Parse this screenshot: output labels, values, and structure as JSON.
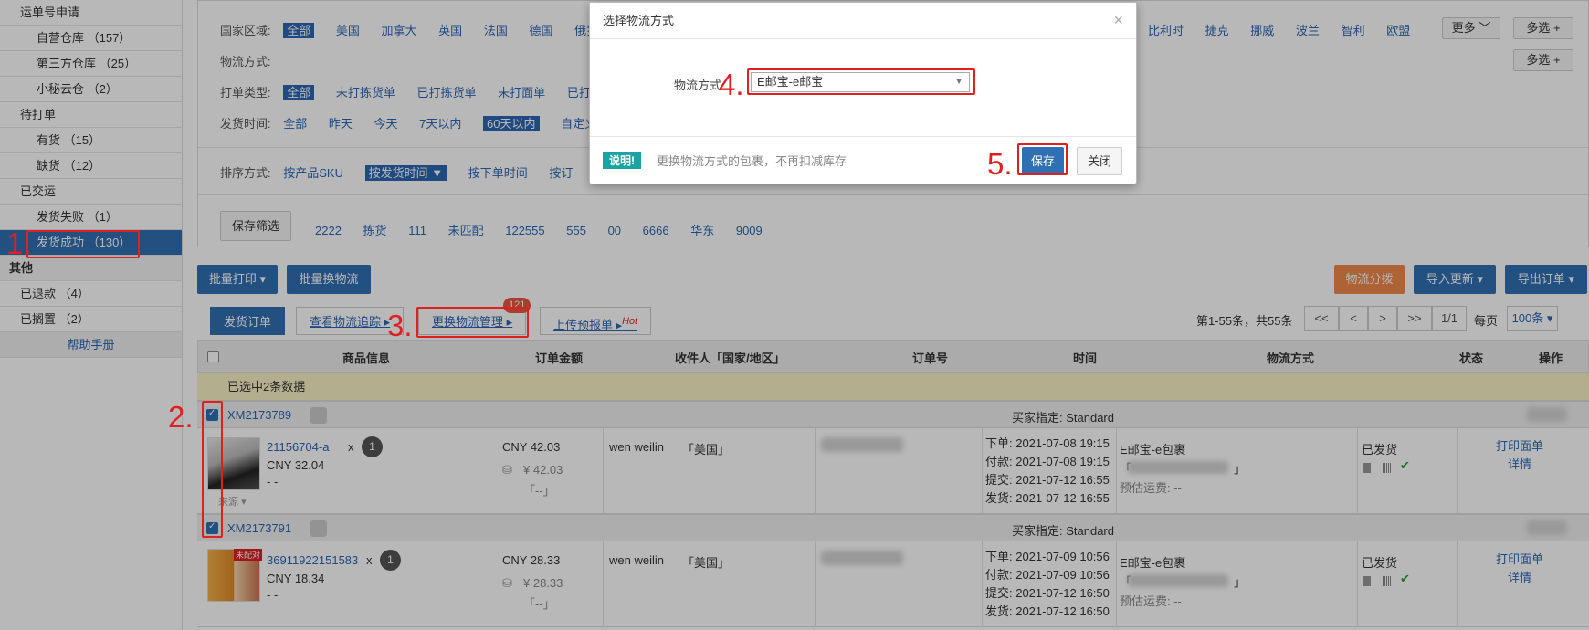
{
  "sidebar": {
    "items": [
      {
        "label": "运单号申请",
        "kind": "grp"
      },
      {
        "label": "自营仓库 （157）",
        "kind": "sub"
      },
      {
        "label": "第三方仓库 （25）",
        "kind": "sub"
      },
      {
        "label": "小秘云仓 （2）",
        "kind": "sub"
      },
      {
        "label": "待打单",
        "kind": "grp2"
      },
      {
        "label": "有货 （15）",
        "kind": "sub"
      },
      {
        "label": "缺货 （12）",
        "kind": "sub"
      },
      {
        "label": "已交运",
        "kind": "grp2"
      },
      {
        "label": "发货失败 （1）",
        "kind": "sub"
      },
      {
        "label": "发货成功 （130）",
        "kind": "active"
      },
      {
        "label": "其他",
        "kind": "head"
      },
      {
        "label": "已退款 （4）",
        "kind": "grp2"
      },
      {
        "label": "已搁置 （2）",
        "kind": "grp2"
      },
      {
        "label": "帮助手册",
        "kind": "help"
      }
    ]
  },
  "filters": {
    "region_label": "国家区域:",
    "region_options": [
      "全部",
      "美国",
      "加拿大",
      "英国",
      "法国",
      "德国",
      "俄罗斯"
    ],
    "region_options_right": [
      "比利时",
      "捷克",
      "挪威",
      "波兰",
      "智利",
      "欧盟"
    ],
    "more_label": "更多",
    "multi_label": "多选",
    "logistics_label": "物流方式:",
    "print_label": "打单类型:",
    "print_options": [
      "全部",
      "未打拣货单",
      "已打拣货单",
      "未打面单",
      "已打"
    ],
    "ship_label": "发货时间:",
    "ship_options": [
      "全部",
      "昨天",
      "今天",
      "7天以内",
      "60天以内",
      "自定义"
    ],
    "sort_label": "排序方式:",
    "sort_options": [
      "按产品SKU",
      "按发货时间",
      "按下单时间",
      "按订"
    ],
    "save_filter": "保存筛选",
    "saved_filters": [
      "2222",
      "拣货",
      "111",
      "未匹配",
      "122555",
      "555",
      "00",
      "6666",
      "华东",
      "9009"
    ]
  },
  "toolbar": {
    "batch_print": "批量打印",
    "batch_logistics": "批量换物流",
    "logistics_split": "物流分拨",
    "import_update": "导入更新",
    "export_order": "导出订单"
  },
  "tabs": {
    "ship_order": "发货订单",
    "track": "查看物流追踪",
    "change_logistics": "更换物流管理",
    "badge": "121",
    "upload": "上传预报单",
    "hot": "Hot"
  },
  "pagination": {
    "summary": "第1-55条，共55条",
    "first": "<<",
    "prev": "<",
    "next": ">",
    "last": ">>",
    "page": "1/1",
    "per_page_label": "每页",
    "per_page_value": "100条"
  },
  "table": {
    "headers": [
      "商品信息",
      "订单金额",
      "收件人「国家/地区」",
      "订单号",
      "时间",
      "物流方式",
      "状态",
      "操作"
    ],
    "selected_text": "已选中2条数据",
    "orders": [
      {
        "id": "XM2173789",
        "buyer_pref": "买家指定:  Standard",
        "sku": "21156704-a",
        "x": "x",
        "qty": "1",
        "price": "CNY 32.04",
        "dash": "- -",
        "source": "来源",
        "tag": "",
        "amount": "CNY 42.03",
        "amount2": "¥ 42.03",
        "amount3": "「--」",
        "recipient": "wen weilin",
        "country": "「美国」",
        "t1": "下单: 2021-07-08 19:15",
        "t2": "付款: 2021-07-08 19:15",
        "t3": "提交: 2021-07-12 16:55",
        "t4": "发货: 2021-07-12 16:55",
        "logistics": "E邮宝-e包裹",
        "logistics2": "「",
        "logistics3": "」",
        "freight": "预估运费: --",
        "status": "已发货",
        "op1": "打印面单",
        "op2": "详情"
      },
      {
        "id": "XM2173791",
        "buyer_pref": "买家指定:  Standard",
        "sku": "36911922151583",
        "x": "x",
        "qty": "1",
        "price": "CNY 18.34",
        "dash": "- -",
        "source": "",
        "tag": "未配对",
        "amount": "CNY 28.33",
        "amount2": "¥ 28.33",
        "amount3": "「--」",
        "recipient": "wen weilin",
        "country": "「美国」",
        "t1": "下单: 2021-07-09 10:56",
        "t2": "付款: 2021-07-09 10:56",
        "t3": "提交: 2021-07-12 16:50",
        "t4": "发货: 2021-07-12 16:50",
        "logistics": "E邮宝-e包裹",
        "logistics2": "「",
        "logistics3": "」",
        "freight": "预估运费: --",
        "status": "已发货",
        "op1": "打印面单",
        "op2": "详情"
      }
    ]
  },
  "modal": {
    "title": "选择物流方式",
    "field_label": "物流方式:",
    "select_value": "E邮宝-e邮宝",
    "note_tag": "说明!",
    "note_text": "更换物流方式的包裹，不再扣减库存",
    "save": "保存",
    "close": "关闭",
    "close_x": "×"
  },
  "annotations": [
    "1.",
    "2.",
    "3.",
    "4.",
    "5."
  ],
  "colors": {
    "primary": "#2f6fb3",
    "annotation": "#e02020",
    "orange": "#f08a4b",
    "teal": "#1aa3a3"
  }
}
